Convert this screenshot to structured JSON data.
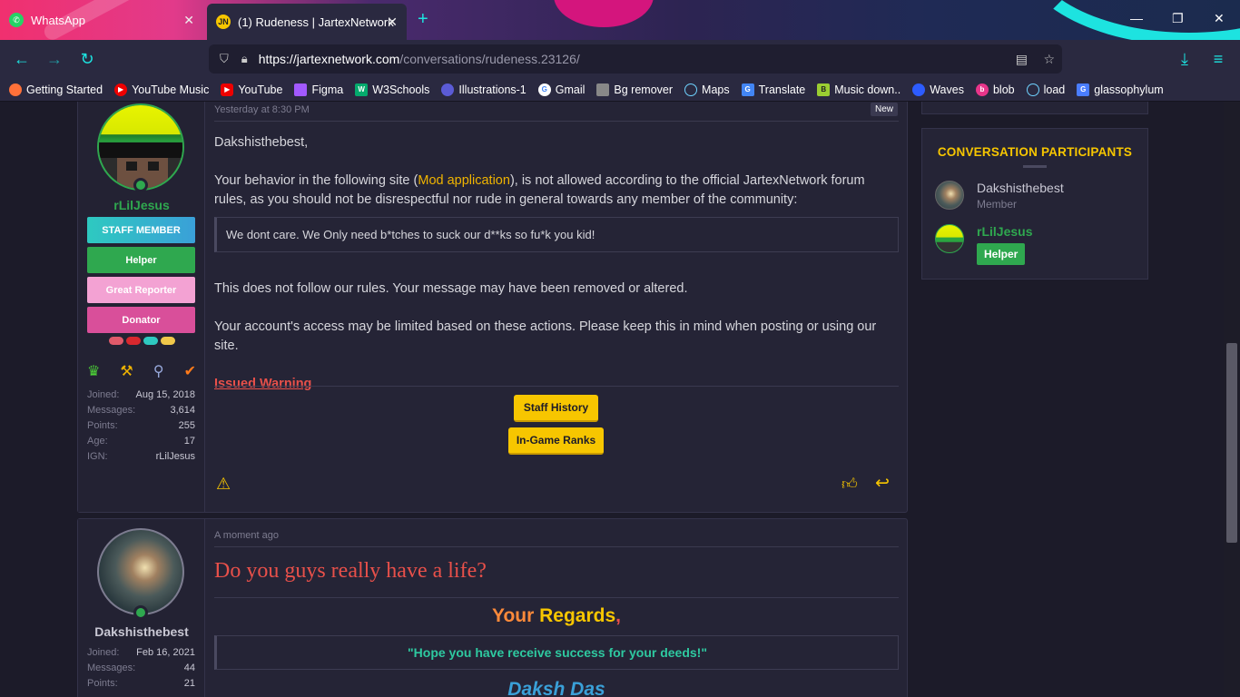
{
  "browser": {
    "tabs": [
      {
        "label": "WhatsApp"
      },
      {
        "label": "(1) Rudeness | JartexNetwork"
      }
    ],
    "url_domain": "https://jartexnetwork.com",
    "url_path": "/conversations/rudeness.23126/",
    "bookmarks": [
      "Getting Started",
      "YouTube Music",
      "YouTube",
      "Figma",
      "W3Schools",
      "Illustrations-1",
      "Gmail",
      "Bg remover",
      "Maps",
      "Translate",
      "Music down..",
      "Waves",
      "blob",
      "load",
      "glassophylum"
    ]
  },
  "post1": {
    "timestamp": "Yesterday at 8:30 PM",
    "new_badge": "New",
    "author": "rLilJesus",
    "badges": [
      "STAFF MEMBER",
      "Helper",
      "Great Reporter",
      "Donator"
    ],
    "stats": [
      {
        "k": "Joined:",
        "v": "Aug 15, 2018"
      },
      {
        "k": "Messages:",
        "v": "3,614"
      },
      {
        "k": "Points:",
        "v": "255"
      },
      {
        "k": "Age:",
        "v": "17"
      },
      {
        "k": "IGN:",
        "v": "rLilJesus"
      }
    ],
    "greeting": "Dakshisthebest,",
    "para1_before": "Your behavior in the following site (",
    "para1_link": "Mod application",
    "para1_after": "), is not allowed according to the official JartexNetwork forum rules, as you should not be disrespectful nor rude in general towards any member of the community:",
    "quote": "We dont care. We Only need b*tches to suck our d**ks so fu*k you kid!",
    "para2": "This does not follow our rules. Your message may have been removed or altered.",
    "para3": "Your account's access may be limited based on these actions. Please keep this in mind when posting or using our site.",
    "warning_link": "Issued Warning",
    "btn_history": "Staff History",
    "btn_ranks": "In-Game Ranks"
  },
  "post2": {
    "timestamp": "A moment ago",
    "author": "Dakshisthebest",
    "stats": [
      {
        "k": "Joined:",
        "v": "Feb 16, 2021"
      },
      {
        "k": "Messages:",
        "v": "44"
      },
      {
        "k": "Points:",
        "v": "21"
      }
    ],
    "headline": "Do you guys really have a life?",
    "sig_your": "Your",
    "sig_regards": "Regards",
    "sig_comma": ",",
    "sig_quote": "\"Hope you have receive success for your deeds!\"",
    "sig_name": "Daksh Das"
  },
  "sidebar": {
    "title": "CONVERSATION PARTICIPANTS",
    "participants": [
      {
        "name": "Dakshisthebest",
        "role": "Member"
      },
      {
        "name": "rLilJesus",
        "role": "Helper"
      }
    ]
  },
  "colors": {
    "accent": "#f7c600",
    "green": "#2fa84f",
    "warn": "#e8504a",
    "cyan": "#1de3e0"
  }
}
